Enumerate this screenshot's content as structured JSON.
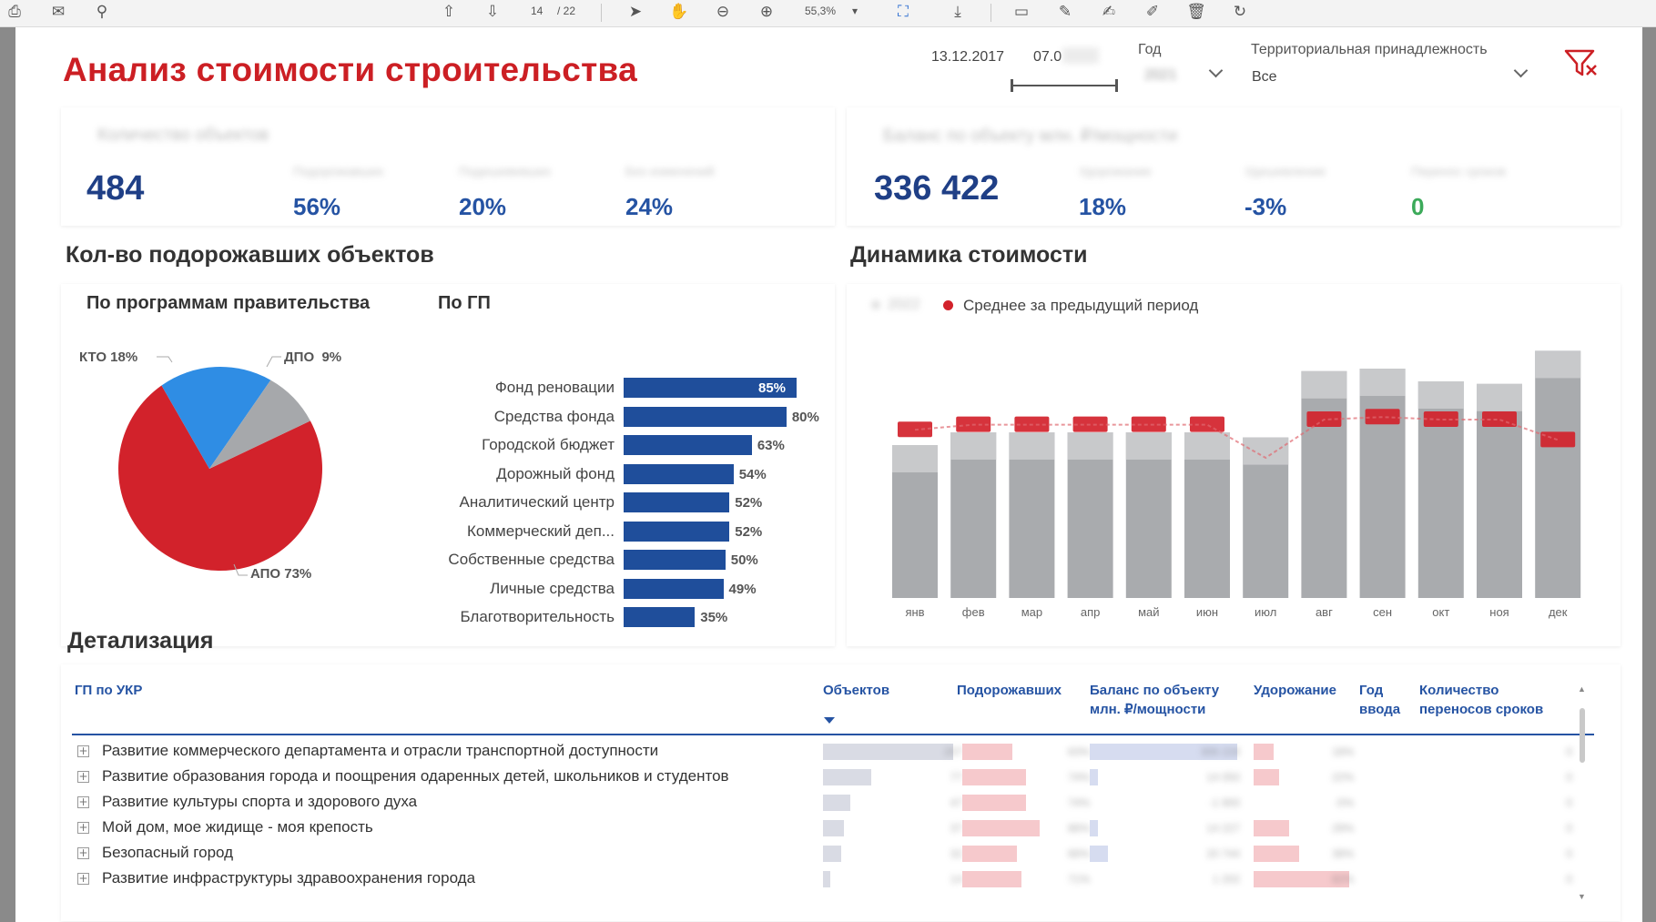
{
  "toolbar": {
    "page_current": "14",
    "page_total": "/ 22",
    "zoom": "55,3%",
    "icons": [
      "print-icon",
      "mail-icon",
      "search-icon",
      "arrow-up-icon",
      "arrow-down-icon",
      "pointer-icon",
      "hand-icon",
      "zoom-out-icon",
      "zoom-in-icon",
      "fit-icon",
      "download-icon",
      "comment-icon",
      "pen-icon",
      "sign-icon",
      "edit-icon",
      "trash-icon",
      "rotate-icon"
    ]
  },
  "header": {
    "title": "Анализ стоимости строительства",
    "date_from": "13.12.2017",
    "date_to": "07.0",
    "year_label": "Год",
    "year_value": "2021",
    "territory_label": "Территориальная принадлежность",
    "territory_value": "Все"
  },
  "kpi_left": {
    "title": "Количество объектов",
    "value": "484",
    "items": [
      {
        "label": "Подорожавших",
        "value": "56%"
      },
      {
        "label": "Подешевевших",
        "value": "20%"
      },
      {
        "label": "Без изменений",
        "value": "24%"
      }
    ]
  },
  "kpi_right": {
    "title": "Баланс по объекту млн. ₽/мощности",
    "value": "336 422",
    "items": [
      {
        "label": "Удорожание",
        "value": "18%"
      },
      {
        "label": "Удешевление",
        "value": "-3%"
      },
      {
        "label": "Перенос сроков",
        "value": "0"
      }
    ]
  },
  "sections": {
    "left": "Кол-во подорожавших объектов",
    "right": "Динамика стоимости",
    "details": "Детализация"
  },
  "pie": {
    "title": "По программам правительства",
    "slices": [
      {
        "label": "АПО 73%",
        "value": 73,
        "color": "#d2222b"
      },
      {
        "label": "КТО 18%",
        "value": 18,
        "color": "#2f8de4"
      },
      {
        "label": "ДПО  9%",
        "value": 9,
        "color": "#a6a8ab"
      }
    ]
  },
  "bars": {
    "title": "По ГП",
    "items": [
      {
        "label": "Фонд реновации",
        "value": 85,
        "text": "85%"
      },
      {
        "label": "Средства фонда",
        "value": 80,
        "text": "80%"
      },
      {
        "label": "Городской бюджет",
        "value": 63,
        "text": "63%"
      },
      {
        "label": "Дорожный фонд",
        "value": 54,
        "text": "54%"
      },
      {
        "label": "Аналитический центр",
        "value": 52,
        "text": "52%"
      },
      {
        "label": "Коммерческий деп...",
        "value": 52,
        "text": "52%"
      },
      {
        "label": "Собственные средства",
        "value": 50,
        "text": "50%"
      },
      {
        "label": "Личные средства",
        "value": 49,
        "text": "49%"
      },
      {
        "label": "Благотворительность",
        "value": 35,
        "text": "35%"
      }
    ]
  },
  "chart_data": {
    "type": "bar",
    "title": "Динамика стоимости",
    "legend": [
      {
        "name": "2022",
        "color": "#a6a8ab"
      },
      {
        "name": "Среднее за предыдущий период",
        "color": "#d2222b"
      }
    ],
    "categories": [
      "янв",
      "фев",
      "мар",
      "апр",
      "май",
      "июн",
      "июл",
      "авг",
      "сен",
      "окт",
      "ноя",
      "дек"
    ],
    "series": [
      {
        "name": "2022",
        "values": [
          60,
          65,
          65,
          65,
          65,
          65,
          63,
          89,
          90,
          85,
          84,
          97
        ]
      },
      {
        "name": "Среднее за предыдущий период",
        "values": [
          66,
          68,
          68,
          68,
          68,
          68,
          55,
          70,
          71,
          70,
          70,
          62
        ]
      }
    ],
    "ylim": [
      0,
      100
    ]
  },
  "table": {
    "headers": {
      "gp": "ГП по УКР",
      "objects": "Объектов",
      "rising": "Подорожавших",
      "balance": "Баланс по объекту млн. ₽/мощности",
      "increase": "Удорожание",
      "year": "Год ввода",
      "transfers": "Количество переносов сроков"
    },
    "rows": [
      {
        "label": "Развитие коммерческого департамента и отрасли транспортной доступности",
        "objects": "207",
        "obj_fill": 0.95,
        "rising": "63%",
        "rising_fill": 0.55,
        "balance": "306 228",
        "bal_fill": 0.95,
        "increase": "18%",
        "inc_fill": 0.2,
        "transfers": "0"
      },
      {
        "label": "Развитие образования города и поощрения одаренных детей, школьников и студентов",
        "objects": "77",
        "obj_fill": 0.35,
        "rising": "74%",
        "rising_fill": 0.7,
        "balance": "14 050",
        "bal_fill": 0.05,
        "increase": "22%",
        "inc_fill": 0.25,
        "transfers": "0"
      },
      {
        "label": "Развитие культуры спорта и здорового духа",
        "objects": "47",
        "obj_fill": 0.2,
        "rising": "74%",
        "rising_fill": 0.7,
        "balance": "-1 900",
        "bal_fill": 0.0,
        "increase": "-5%",
        "inc_fill": 0.0,
        "transfers": "0"
      },
      {
        "label": "Мой дом, мое жидище - моя крепость",
        "objects": "37",
        "obj_fill": 0.15,
        "rising": "86%",
        "rising_fill": 0.85,
        "balance": "14 227",
        "bal_fill": 0.05,
        "increase": "29%",
        "inc_fill": 0.35,
        "transfers": "0"
      },
      {
        "label": "Безопасный город",
        "objects": "32",
        "obj_fill": 0.13,
        "rising": "66%",
        "rising_fill": 0.6,
        "balance": "20 744",
        "bal_fill": 0.12,
        "increase": "38%",
        "inc_fill": 0.45,
        "transfers": "0"
      },
      {
        "label": "Развитие инфраструктуры здравоохранения города",
        "objects": "14",
        "obj_fill": 0.05,
        "rising": "71%",
        "rising_fill": 0.65,
        "balance": "1 202",
        "bal_fill": 0.0,
        "increase": "82%",
        "inc_fill": 0.95,
        "transfers": "0"
      }
    ]
  },
  "colors": {
    "accent_red": "#cc1f24",
    "bar_blue": "#1f4e9b",
    "kpi_blue": "#1f3f86",
    "positive_green": "#3caa5a",
    "grey": "#a6a8ab"
  }
}
